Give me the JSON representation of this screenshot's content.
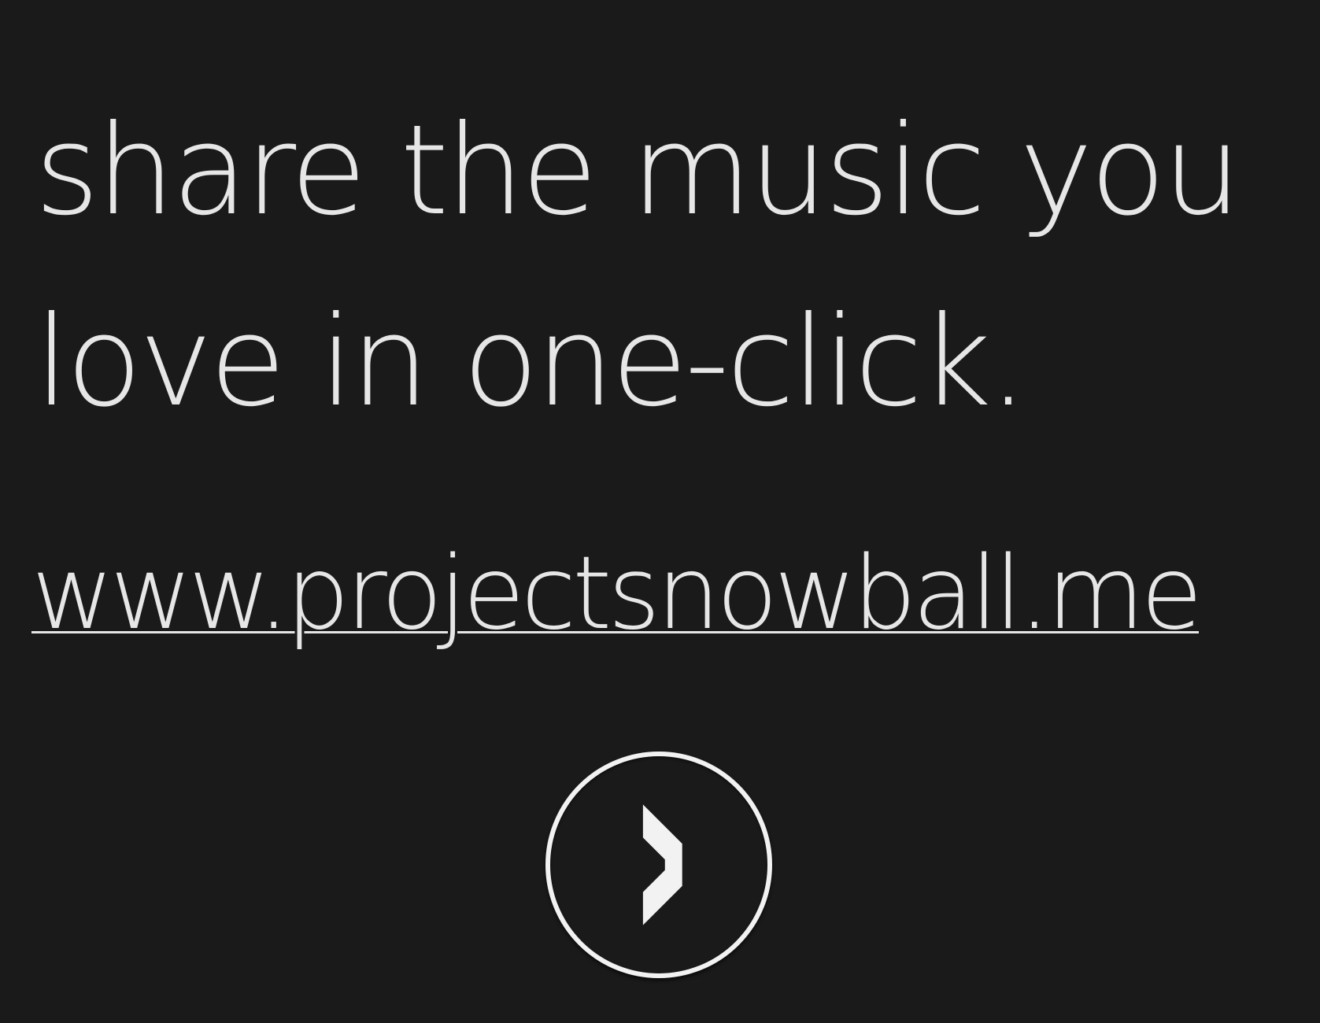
{
  "tagline": {
    "line1": "share the music you",
    "line2": "love in one-click."
  },
  "link": {
    "text": "www.projectsnowball.me"
  },
  "next_button": {
    "icon": "chevron-right-icon"
  },
  "colors": {
    "background": "#1a1a1a",
    "text": "#e6e6e6",
    "button": "#f2f2f2"
  }
}
